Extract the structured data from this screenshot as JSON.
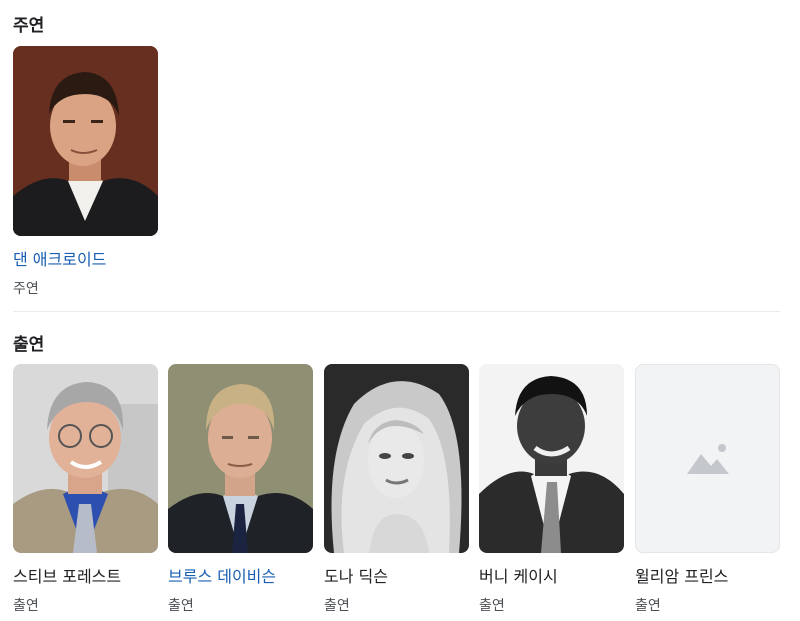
{
  "lead": {
    "title": "주연",
    "cast": [
      {
        "name": "댄 애크로이드",
        "role": "주연",
        "linked": true
      }
    ]
  },
  "supporting": {
    "title": "출연",
    "cast": [
      {
        "name": "스티브 포레스트",
        "role": "출연",
        "linked": false
      },
      {
        "name": "브루스 데이비슨",
        "role": "출연",
        "linked": true
      },
      {
        "name": "도나 딕슨",
        "role": "출연",
        "linked": false
      },
      {
        "name": "버니 케이시",
        "role": "출연",
        "linked": false
      },
      {
        "name": "윌리암 프린스",
        "role": "출연",
        "linked": false
      }
    ]
  },
  "icons": {
    "placeholder": "image-placeholder-icon"
  }
}
